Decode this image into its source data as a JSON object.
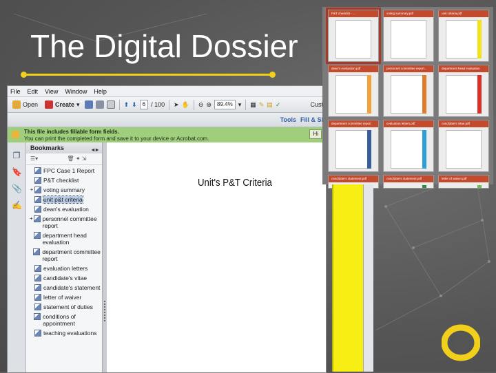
{
  "slide": {
    "title": "The Digital Dossier",
    "accent_color": "#f2cf1a",
    "logo_icon": "university-o-logo-icon"
  },
  "acrobat": {
    "menu": [
      "File",
      "Edit",
      "View",
      "Window",
      "Help"
    ],
    "toolbar": {
      "open_label": "Open",
      "create_label": "Create",
      "page_current": "6",
      "page_total": "/ 100",
      "zoom": "89.4%",
      "customize_label": "Cust"
    },
    "toolbar2": {
      "tools_label": "Tools",
      "fill_sign_label": "Fill & Si"
    },
    "notice": {
      "line1": "This file includes fillable form fields.",
      "line2": "You can print the completed form and save it to your device or Acrobat.com.",
      "highlight_label": "Hi"
    },
    "bookmarks": {
      "header": "Bookmarks",
      "items": [
        {
          "label": "FPC Case 1 Report",
          "expand": ""
        },
        {
          "label": "P&T checklist",
          "expand": ""
        },
        {
          "label": "voting summary",
          "expand": "+"
        },
        {
          "label": "unit p&t criteria",
          "expand": "",
          "selected": true
        },
        {
          "label": "dean's evaluation",
          "expand": ""
        },
        {
          "label": "personnel committee report",
          "expand": "+"
        },
        {
          "label": "department head evaluation",
          "expand": ""
        },
        {
          "label": "department committee report",
          "expand": ""
        },
        {
          "label": "evaluation letters",
          "expand": ""
        },
        {
          "label": "candidate's vitae",
          "expand": ""
        },
        {
          "label": "candidate's statement",
          "expand": ""
        },
        {
          "label": "letter of waiver",
          "expand": ""
        },
        {
          "label": "statement of duties",
          "expand": ""
        },
        {
          "label": "conditions of appointment",
          "expand": ""
        },
        {
          "label": "teaching evaluations",
          "expand": ""
        }
      ]
    },
    "document": {
      "heading": "Unit's P&T Criteria"
    }
  },
  "thumbnails": [
    {
      "label": "P&T checklist - ...",
      "bar_color": "",
      "selected": true
    },
    {
      "label": "voting summary.pdf",
      "bar_color": ""
    },
    {
      "label": "unit criteria.pdf",
      "bar_color": "#f3e21b"
    },
    {
      "label": "dean's evaluation.pdf",
      "bar_color": "#f2a23a"
    },
    {
      "label": "personnel committee report...",
      "bar_color": "#e07a2c"
    },
    {
      "label": "department head evaluation",
      "bar_color": "#d9312a"
    },
    {
      "label": "department committee report",
      "bar_color": "#3a5e9c"
    },
    {
      "label": "evaluation letters.pdf",
      "bar_color": "#2e9fd6"
    },
    {
      "label": "candidate's vitae.pdf",
      "bar_color": ""
    },
    {
      "label": "candidate's statement.pdf",
      "bar_color": "#4caf50"
    },
    {
      "label": "candidate's statement.pdf",
      "bar_color": "#2e8b3e"
    },
    {
      "label": "letter of waiver.pdf",
      "bar_color": "#6cbf46"
    }
  ]
}
